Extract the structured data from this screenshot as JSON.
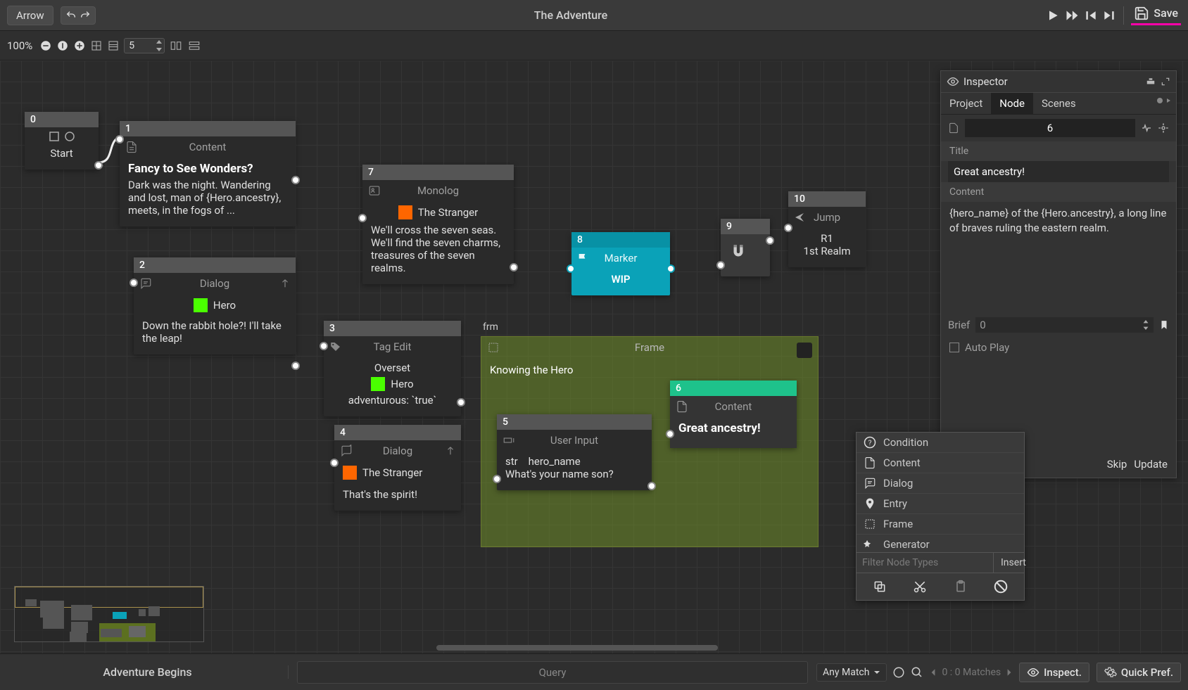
{
  "topbar": {
    "tool_label": "Arrow",
    "title": "The Adventure",
    "save_label": "Save"
  },
  "toolbar2": {
    "zoom": "100%",
    "grid_step": "5"
  },
  "nodes": {
    "n0": {
      "id": "0",
      "label": "Start"
    },
    "n1": {
      "id": "1",
      "type": "Content",
      "title": "Fancy to See Wonders?",
      "body": "Dark was the night. Wandering and lost, man of {Hero.ancestry}, meets, in the fogs of ..."
    },
    "n2": {
      "id": "2",
      "type": "Dialog",
      "speaker": "Hero",
      "body": "Down the rabbit hole?! I'll take the leap!"
    },
    "n3": {
      "id": "3",
      "type": "Tag Edit",
      "caption": "Overset",
      "target": "Hero",
      "line": "adventurous: `true`"
    },
    "n4": {
      "id": "4",
      "type": "Dialog",
      "speaker": "The Stranger",
      "body": "That's the spirit!"
    },
    "n5": {
      "id": "5",
      "type": "User Input",
      "vartype": "str",
      "varname": "hero_name",
      "prompt": "What's your name son?"
    },
    "n6": {
      "id": "6",
      "type": "Content",
      "title": "Great ancestry!"
    },
    "n7": {
      "id": "7",
      "type": "Monolog",
      "speaker": "The Stranger",
      "body": "We'll cross the seven seas. We'll find the seven charms, treasures of the seven realms."
    },
    "n8": {
      "id": "8",
      "type": "Marker",
      "label": "WIP"
    },
    "n9": {
      "id": "9"
    },
    "n10": {
      "id": "10",
      "type": "Jump",
      "line1": "R1",
      "line2": "1st Realm"
    },
    "frame": {
      "short": "frm",
      "type": "Frame",
      "title": "Knowing the Hero"
    }
  },
  "inspector": {
    "title": "Inspector",
    "tabs": {
      "project": "Project",
      "node": "Node",
      "scenes": "Scenes"
    },
    "id": "6",
    "section_title": "Title",
    "title_value": "Great ancestry!",
    "section_content": "Content",
    "content_value": "{hero_name} of the {Hero.ancestry}, a long line of braves ruling the eastern realm.",
    "brief_label": "Brief",
    "brief_value": "0",
    "autoplay_label": "Auto Play",
    "skip": "Skip",
    "update": "Update"
  },
  "contextmenu": {
    "items": [
      "Condition",
      "Content",
      "Dialog",
      "Entry",
      "Frame",
      "Generator"
    ],
    "filter_placeholder": "Filter Node Types",
    "insert": "Insert"
  },
  "bottombar": {
    "scene": "Adventure Begins",
    "query_placeholder": "Query",
    "match_mode": "Any Match",
    "matches": "0 : 0 Matches",
    "inspect": "Inspect.",
    "quickpref": "Quick Pref."
  }
}
